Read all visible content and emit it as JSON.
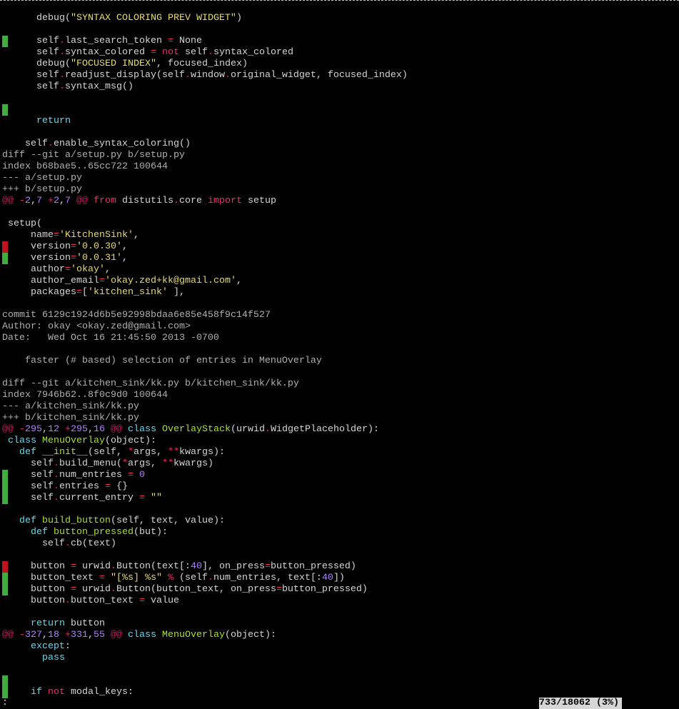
{
  "colors": {
    "default": "#d6d6d6",
    "string": "#e6db74",
    "keyword": "#66d9ef",
    "op": "#f92672",
    "number": "#ae81ff",
    "classname": "#a6e22e",
    "meta": "#b0b0b0",
    "hunk": "#c2185b",
    "added_marker": "#3fae3f",
    "removed_marker": "#c1121f"
  },
  "lines": [
    {
      "segments": [
        [
          "      debug(",
          "default"
        ],
        [
          "\"SYNTAX COLORING PREV WIDGET\"",
          "string"
        ],
        [
          ")",
          "default"
        ]
      ]
    },
    {
      "segments": []
    },
    {
      "marker": "added",
      "segments": [
        [
          "      self",
          "default"
        ],
        [
          ".",
          "op"
        ],
        [
          "last_search_token ",
          "default"
        ],
        [
          "=",
          "op"
        ],
        [
          " None",
          "default"
        ]
      ]
    },
    {
      "segments": [
        [
          "      self",
          "default"
        ],
        [
          ".",
          "op"
        ],
        [
          "syntax_colored ",
          "default"
        ],
        [
          "=",
          "op"
        ],
        [
          " ",
          "default"
        ],
        [
          "not",
          "op"
        ],
        [
          " self",
          "default"
        ],
        [
          ".",
          "op"
        ],
        [
          "syntax_colored",
          "default"
        ]
      ]
    },
    {
      "segments": [
        [
          "      debug(",
          "default"
        ],
        [
          "\"FOCUSED INDEX\"",
          "string"
        ],
        [
          ", focused_index)",
          "default"
        ]
      ]
    },
    {
      "segments": [
        [
          "      self",
          "default"
        ],
        [
          ".",
          "op"
        ],
        [
          "readjust_display(self",
          "default"
        ],
        [
          ".",
          "op"
        ],
        [
          "window",
          "default"
        ],
        [
          ".",
          "op"
        ],
        [
          "original_widget, focused_index)",
          "default"
        ]
      ]
    },
    {
      "segments": [
        [
          "      self",
          "default"
        ],
        [
          ".",
          "op"
        ],
        [
          "syntax_msg()",
          "default"
        ]
      ]
    },
    {
      "segments": []
    },
    {
      "marker": "added",
      "segments": []
    },
    {
      "segments": [
        [
          "      ",
          "default"
        ],
        [
          "return",
          "keyword"
        ]
      ]
    },
    {
      "segments": []
    },
    {
      "segments": [
        [
          "    self",
          "default"
        ],
        [
          ".",
          "op"
        ],
        [
          "enable_syntax_coloring()",
          "default"
        ]
      ]
    },
    {
      "segments": [
        [
          "diff --git a/setup.py b/setup.py",
          "meta"
        ]
      ]
    },
    {
      "segments": [
        [
          "index b68bae5..65cc722 100644",
          "meta"
        ]
      ]
    },
    {
      "segments": [
        [
          "--- a/setup.py",
          "meta"
        ]
      ]
    },
    {
      "segments": [
        [
          "+++ b/setup.py",
          "meta"
        ]
      ]
    },
    {
      "segments": [
        [
          "@@",
          "hunk"
        ],
        [
          " ",
          "default"
        ],
        [
          "-",
          "op"
        ],
        [
          "2",
          "number"
        ],
        [
          ",",
          "default"
        ],
        [
          "7",
          "number"
        ],
        [
          " ",
          "default"
        ],
        [
          "+",
          "op"
        ],
        [
          "2",
          "number"
        ],
        [
          ",",
          "default"
        ],
        [
          "7",
          "number"
        ],
        [
          " ",
          "default"
        ],
        [
          "@@",
          "hunk"
        ],
        [
          " ",
          "default"
        ],
        [
          "from",
          "op"
        ],
        [
          " distutils",
          "default"
        ],
        [
          ".",
          "op"
        ],
        [
          "core ",
          "default"
        ],
        [
          "import",
          "op"
        ],
        [
          " setup",
          "default"
        ]
      ]
    },
    {
      "segments": []
    },
    {
      "segments": [
        [
          " setup(",
          "default"
        ]
      ]
    },
    {
      "segments": [
        [
          "     name",
          "default"
        ],
        [
          "=",
          "op"
        ],
        [
          "'KitchenSink'",
          "string"
        ],
        [
          ",",
          "default"
        ]
      ]
    },
    {
      "marker": "removed",
      "segments": [
        [
          "     version",
          "default"
        ],
        [
          "=",
          "op"
        ],
        [
          "'0.0.30'",
          "string"
        ],
        [
          ",",
          "default"
        ]
      ]
    },
    {
      "marker": "added",
      "segments": [
        [
          "     version",
          "default"
        ],
        [
          "=",
          "op"
        ],
        [
          "'0.0.31'",
          "string"
        ],
        [
          ",",
          "default"
        ]
      ]
    },
    {
      "segments": [
        [
          "     author",
          "default"
        ],
        [
          "=",
          "op"
        ],
        [
          "'okay'",
          "string"
        ],
        [
          ",",
          "default"
        ]
      ]
    },
    {
      "segments": [
        [
          "     author_email",
          "default"
        ],
        [
          "=",
          "op"
        ],
        [
          "'okay.zed+kk@gmail.com'",
          "string"
        ],
        [
          ",",
          "default"
        ]
      ]
    },
    {
      "segments": [
        [
          "     packages",
          "default"
        ],
        [
          "=",
          "op"
        ],
        [
          "[",
          "default"
        ],
        [
          "'kitchen_sink'",
          "string"
        ],
        [
          " ],",
          "default"
        ]
      ]
    },
    {
      "segments": []
    },
    {
      "segments": [
        [
          "commit 6129c1924d6b5e92998bdaa6e85e458f9c14f527",
          "meta"
        ]
      ]
    },
    {
      "segments": [
        [
          "Author: okay <okay.zed@gmail.com>",
          "meta"
        ]
      ]
    },
    {
      "segments": [
        [
          "Date:   Wed Oct 16 21:45:50 2013 -0700",
          "meta"
        ]
      ]
    },
    {
      "segments": []
    },
    {
      "segments": [
        [
          "    faster (# based) selection of entries in MenuOverlay",
          "meta"
        ]
      ]
    },
    {
      "segments": []
    },
    {
      "segments": [
        [
          "diff --git a/kitchen_sink/kk.py b/kitchen_sink/kk.py",
          "meta"
        ]
      ]
    },
    {
      "segments": [
        [
          "index 7946b62..8f0c9d0 100644",
          "meta"
        ]
      ]
    },
    {
      "segments": [
        [
          "--- a/kitchen_sink/kk.py",
          "meta"
        ]
      ]
    },
    {
      "segments": [
        [
          "+++ b/kitchen_sink/kk.py",
          "meta"
        ]
      ]
    },
    {
      "segments": [
        [
          "@@",
          "hunk"
        ],
        [
          " ",
          "default"
        ],
        [
          "-",
          "op"
        ],
        [
          "295",
          "number"
        ],
        [
          ",",
          "default"
        ],
        [
          "12",
          "number"
        ],
        [
          " ",
          "default"
        ],
        [
          "+",
          "op"
        ],
        [
          "295",
          "number"
        ],
        [
          ",",
          "default"
        ],
        [
          "16",
          "number"
        ],
        [
          " ",
          "default"
        ],
        [
          "@@",
          "hunk"
        ],
        [
          " ",
          "default"
        ],
        [
          "class",
          "keyword"
        ],
        [
          " ",
          "default"
        ],
        [
          "OverlayStack",
          "classname"
        ],
        [
          "(urwid",
          "default"
        ],
        [
          ".",
          "op"
        ],
        [
          "WidgetPlaceholder):",
          "default"
        ]
      ]
    },
    {
      "segments": [
        [
          " ",
          "default"
        ],
        [
          "class",
          "keyword"
        ],
        [
          " ",
          "default"
        ],
        [
          "MenuOverlay",
          "classname"
        ],
        [
          "(object):",
          "default"
        ]
      ]
    },
    {
      "segments": [
        [
          "   ",
          "default"
        ],
        [
          "def",
          "keyword"
        ],
        [
          " ",
          "default"
        ],
        [
          "__init__",
          "classname"
        ],
        [
          "(self, ",
          "default"
        ],
        [
          "*",
          "op"
        ],
        [
          "args, ",
          "default"
        ],
        [
          "**",
          "op"
        ],
        [
          "kwargs):",
          "default"
        ]
      ]
    },
    {
      "segments": [
        [
          "     self",
          "default"
        ],
        [
          ".",
          "op"
        ],
        [
          "build_menu(",
          "default"
        ],
        [
          "*",
          "op"
        ],
        [
          "args, ",
          "default"
        ],
        [
          "**",
          "op"
        ],
        [
          "kwargs)",
          "default"
        ]
      ]
    },
    {
      "marker": "added",
      "segments": [
        [
          "     self",
          "default"
        ],
        [
          ".",
          "op"
        ],
        [
          "num_entries ",
          "default"
        ],
        [
          "=",
          "op"
        ],
        [
          " ",
          "default"
        ],
        [
          "0",
          "number"
        ]
      ]
    },
    {
      "marker": "added",
      "segments": [
        [
          "     self",
          "default"
        ],
        [
          ".",
          "op"
        ],
        [
          "entries ",
          "default"
        ],
        [
          "=",
          "op"
        ],
        [
          " {}",
          "default"
        ]
      ]
    },
    {
      "marker": "added",
      "segments": [
        [
          "     self",
          "default"
        ],
        [
          ".",
          "op"
        ],
        [
          "current_entry ",
          "default"
        ],
        [
          "=",
          "op"
        ],
        [
          " ",
          "default"
        ],
        [
          "\"\"",
          "string"
        ]
      ]
    },
    {
      "segments": []
    },
    {
      "segments": [
        [
          "   ",
          "default"
        ],
        [
          "def",
          "keyword"
        ],
        [
          " ",
          "default"
        ],
        [
          "build_button",
          "classname"
        ],
        [
          "(self, text, value):",
          "default"
        ]
      ]
    },
    {
      "segments": [
        [
          "     ",
          "default"
        ],
        [
          "def",
          "keyword"
        ],
        [
          " ",
          "default"
        ],
        [
          "button_pressed",
          "classname"
        ],
        [
          "(but):",
          "default"
        ]
      ]
    },
    {
      "segments": [
        [
          "       self",
          "default"
        ],
        [
          ".",
          "op"
        ],
        [
          "cb(text)",
          "default"
        ]
      ]
    },
    {
      "segments": []
    },
    {
      "marker": "removed",
      "segments": [
        [
          "     button ",
          "default"
        ],
        [
          "=",
          "op"
        ],
        [
          " urwid",
          "default"
        ],
        [
          ".",
          "op"
        ],
        [
          "Button(text[:",
          "default"
        ],
        [
          "40",
          "number"
        ],
        [
          "], on_press",
          "default"
        ],
        [
          "=",
          "op"
        ],
        [
          "button_pressed)",
          "default"
        ]
      ]
    },
    {
      "marker": "added",
      "segments": [
        [
          "     button_text ",
          "default"
        ],
        [
          "=",
          "op"
        ],
        [
          " ",
          "default"
        ],
        [
          "\"[%s] %s\"",
          "string"
        ],
        [
          " ",
          "default"
        ],
        [
          "%",
          "op"
        ],
        [
          " (self",
          "default"
        ],
        [
          ".",
          "op"
        ],
        [
          "num_entries, text[:",
          "default"
        ],
        [
          "40",
          "number"
        ],
        [
          "])",
          "default"
        ]
      ]
    },
    {
      "marker": "added",
      "segments": [
        [
          "     button ",
          "default"
        ],
        [
          "=",
          "op"
        ],
        [
          " urwid",
          "default"
        ],
        [
          ".",
          "op"
        ],
        [
          "Button(button_text, on_press",
          "default"
        ],
        [
          "=",
          "op"
        ],
        [
          "button_pressed)",
          "default"
        ]
      ]
    },
    {
      "segments": [
        [
          "     button",
          "default"
        ],
        [
          ".",
          "op"
        ],
        [
          "button_text ",
          "default"
        ],
        [
          "=",
          "op"
        ],
        [
          " value",
          "default"
        ]
      ]
    },
    {
      "segments": []
    },
    {
      "segments": [
        [
          "     ",
          "default"
        ],
        [
          "return",
          "keyword"
        ],
        [
          " button",
          "default"
        ]
      ]
    },
    {
      "segments": [
        [
          "@@",
          "hunk"
        ],
        [
          " ",
          "default"
        ],
        [
          "-",
          "op"
        ],
        [
          "327",
          "number"
        ],
        [
          ",",
          "default"
        ],
        [
          "18",
          "number"
        ],
        [
          " ",
          "default"
        ],
        [
          "+",
          "op"
        ],
        [
          "331",
          "number"
        ],
        [
          ",",
          "default"
        ],
        [
          "55",
          "number"
        ],
        [
          " ",
          "default"
        ],
        [
          "@@",
          "hunk"
        ],
        [
          " ",
          "default"
        ],
        [
          "class",
          "keyword"
        ],
        [
          " ",
          "default"
        ],
        [
          "MenuOverlay",
          "classname"
        ],
        [
          "(object):",
          "default"
        ]
      ]
    },
    {
      "segments": [
        [
          "     ",
          "default"
        ],
        [
          "except",
          "keyword"
        ],
        [
          ":",
          "default"
        ]
      ]
    },
    {
      "segments": [
        [
          "       ",
          "default"
        ],
        [
          "pass",
          "keyword"
        ]
      ]
    },
    {
      "segments": []
    },
    {
      "marker": "added",
      "segments": []
    },
    {
      "marker": "added",
      "segments": [
        [
          "     ",
          "default"
        ],
        [
          "if",
          "keyword"
        ],
        [
          " ",
          "default"
        ],
        [
          "not",
          "op"
        ],
        [
          " modal_keys:",
          "default"
        ]
      ]
    }
  ],
  "status": {
    "prompt": ":",
    "position": "733/18062 (3%)"
  }
}
